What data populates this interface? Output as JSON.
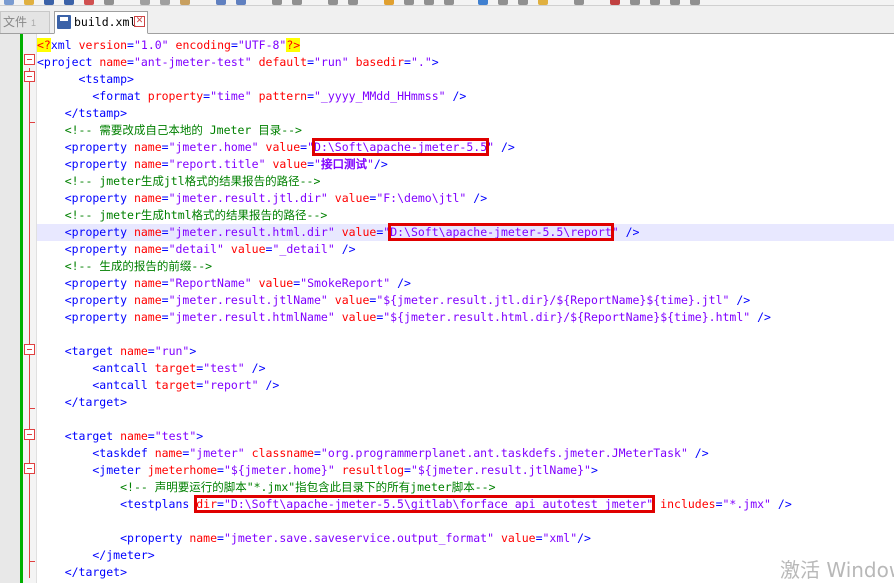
{
  "tabs": [
    {
      "label": "文件",
      "number": "1",
      "active": false
    },
    {
      "label": "build.xml",
      "close": "✕",
      "active": true
    }
  ],
  "editor": {
    "lines": [
      {
        "html": "<span class=\"pi\">&lt;?</span><span class=\"kw\">xml</span> <span class=\"attr\">version</span>=<span class=\"val\">\"1.0\"</span> <span class=\"attr\">encoding</span>=<span class=\"val\">\"UTF-8\"</span><span class=\"pi\">?&gt;</span>"
      },
      {
        "html": "&lt;project <span class=\"attr\">name</span>=<span class=\"val\">\"ant-jmeter-test\"</span> <span class=\"attr\">default</span>=<span class=\"val\">\"run\"</span> <span class=\"attr\">basedir</span>=<span class=\"val\">\".\"</span>&gt;"
      },
      {
        "html": "      &lt;tstamp&gt;"
      },
      {
        "html": "        &lt;format <span class=\"attr\">property</span>=<span class=\"val\">\"time\"</span> <span class=\"attr\">pattern</span>=<span class=\"val\">\"_yyyy_MMdd_HHmmss\"</span> /&gt;"
      },
      {
        "html": "    &lt;/tstamp&gt;"
      },
      {
        "html": "    <span class=\"cm\">&lt;!-- 需要改成自己本地的 Jmeter 目录--&gt;</span>"
      },
      {
        "html": "    &lt;property <span class=\"attr\">name</span>=<span class=\"val\">\"jmeter.home\"</span> <span class=\"attr\">value</span>=<span class=\"val\">\"<span class=\"hl\">D:\\Soft\\apache-jmeter-5.5</span>\"</span> /&gt;"
      },
      {
        "html": "    &lt;property <span class=\"attr\">name</span>=<span class=\"val\">\"report.title\"</span> <span class=\"attr\">value</span>=<span class=\"val\">\"<span class=\"bold\">接口测试</span>\"</span>/&gt;"
      },
      {
        "html": "    <span class=\"cm\">&lt;!-- jmeter生成jtl格式的结果报告的路径--&gt;</span>"
      },
      {
        "html": "    &lt;property <span class=\"attr\">name</span>=<span class=\"val\">\"jmeter.result.jtl.dir\"</span> <span class=\"attr\">value</span>=<span class=\"val\">\"F:\\demo\\jtl\"</span> /&gt;"
      },
      {
        "html": "    <span class=\"cm\">&lt;!-- jmeter生成html格式的结果报告的路径--&gt;</span>"
      },
      {
        "html": "    &lt;property <span class=\"attr\">name</span>=<span class=\"val\">\"jmeter.result.html.dir\"</span> <span class=\"attr\">value</span>=<span class=\"val\">\"<span class=\"hl\">D:\\Soft\\apache-jmeter-5.5\\report</span>\"</span> /&gt;",
        "current": true
      },
      {
        "html": "    &lt;property <span class=\"attr\">name</span>=<span class=\"val\">\"detail\"</span> <span class=\"attr\">value</span>=<span class=\"val\">\"_detail\"</span> /&gt;"
      },
      {
        "html": "    <span class=\"cm\">&lt;!-- 生成的报告的前缀--&gt;</span>"
      },
      {
        "html": "    &lt;property <span class=\"attr\">name</span>=<span class=\"val\">\"ReportName\"</span> <span class=\"attr\">value</span>=<span class=\"val\">\"SmokeReport\"</span> /&gt;"
      },
      {
        "html": "    &lt;property <span class=\"attr\">name</span>=<span class=\"val\">\"jmeter.result.jtlName\"</span> <span class=\"attr\">value</span>=<span class=\"val\">\"${jmeter.result.jtl.dir}/${ReportName}${time}.jtl\"</span> /&gt;"
      },
      {
        "html": "    &lt;property <span class=\"attr\">name</span>=<span class=\"val\">\"jmeter.result.htmlName\"</span> <span class=\"attr\">value</span>=<span class=\"val\">\"${jmeter.result.html.dir}/${ReportName}${time}.html\"</span> /&gt;"
      },
      {
        "html": ""
      },
      {
        "html": "    &lt;target <span class=\"attr\">name</span>=<span class=\"val\">\"run\"</span>&gt;"
      },
      {
        "html": "        &lt;antcall <span class=\"attr\">target</span>=<span class=\"val\">\"test\"</span> /&gt;"
      },
      {
        "html": "        &lt;antcall <span class=\"attr\">target</span>=<span class=\"val\">\"report\"</span> /&gt;"
      },
      {
        "html": "    &lt;/target&gt;"
      },
      {
        "html": ""
      },
      {
        "html": "    &lt;target <span class=\"attr\">name</span>=<span class=\"val\">\"test\"</span>&gt;"
      },
      {
        "html": "        &lt;taskdef <span class=\"attr\">name</span>=<span class=\"val\">\"jmeter\"</span> <span class=\"attr\">classname</span>=<span class=\"val\">\"org.programmerplanet.ant.taskdefs.jmeter.JMeterTask\"</span> /&gt;"
      },
      {
        "html": "        &lt;jmeter <span class=\"attr\">jmeterhome</span>=<span class=\"val\">\"${jmeter.home}\"</span> <span class=\"attr\">resultlog</span>=<span class=\"val\">\"${jmeter.result.jtlName}\"</span>&gt;"
      },
      {
        "html": "            <span class=\"cm\">&lt;!-- 声明要运行的脚本\"*.jmx\"指包含此目录下的所有jmeter脚本--&gt;</span>"
      },
      {
        "html": "            &lt;testplans <span class=\"hl\"><span class=\"attr\">dir</span>=<span class=\"val\">\"D:\\Soft\\apache-jmeter-5.5\\gitlab\\forface_api_autotest_jmeter\"</span></span> <span class=\"attr\">includes</span>=<span class=\"val\">\"*.jmx\"</span> /&gt;"
      },
      {
        "html": ""
      },
      {
        "html": "            &lt;property <span class=\"attr\">name</span>=<span class=\"val\">\"jmeter.save.saveservice.output_format\"</span> <span class=\"attr\">value</span>=<span class=\"val\">\"xml\"</span>/&gt;"
      },
      {
        "html": "        &lt;/jmeter&gt;"
      },
      {
        "html": "    &lt;/target&gt;"
      }
    ]
  },
  "watermark": "激活 Windows"
}
